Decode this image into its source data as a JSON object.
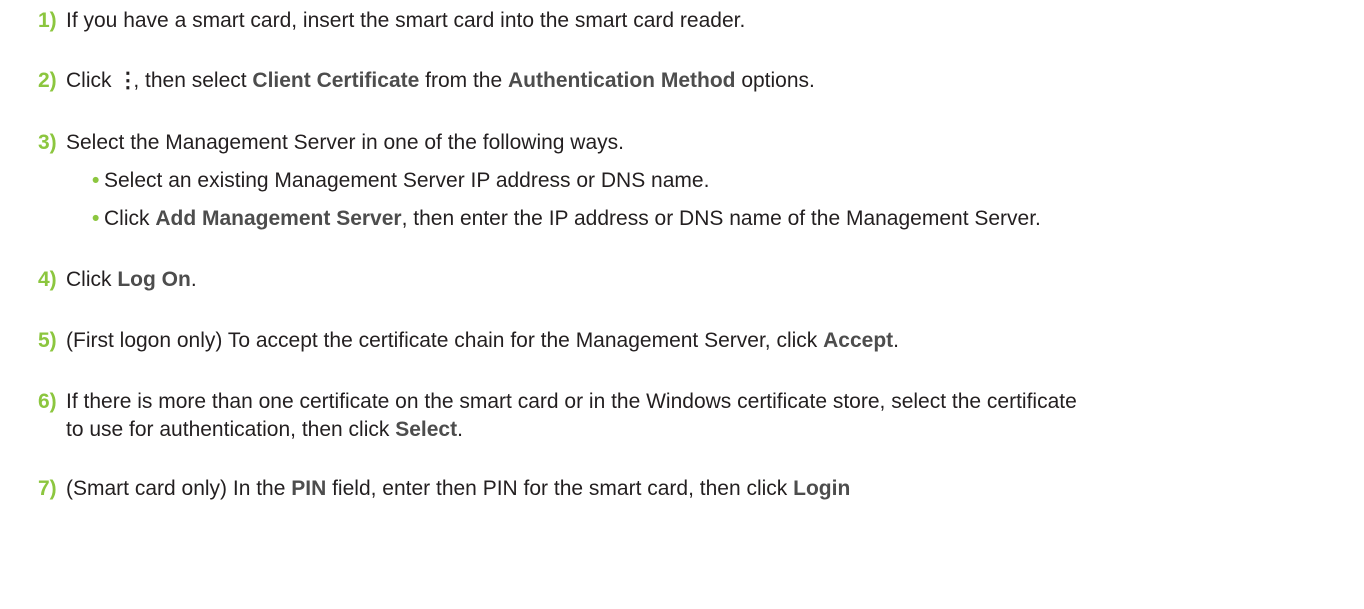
{
  "steps": [
    {
      "number": "1)",
      "text": "If you have a smart card, insert the smart card into the smart card reader."
    },
    {
      "number": "2)",
      "pre": "Click ",
      "icon": "⋮",
      "mid1": ", then select ",
      "bold1": "Client Certificate",
      "mid2": " from the ",
      "bold2": "Authentication Method",
      "post": " options."
    },
    {
      "number": "3)",
      "text": "Select the Management Server in one of the following ways.",
      "bullets": [
        {
          "text": "Select an existing Management Server IP address or DNS name."
        },
        {
          "pre": "Click ",
          "bold": "Add Management Server",
          "post": ", then enter the IP address or DNS name of the Management Server."
        }
      ]
    },
    {
      "number": "4)",
      "pre": "Click ",
      "bold": "Log On",
      "post": "."
    },
    {
      "number": "5)",
      "pre": "(First logon only) To accept the certificate chain for the Management Server, click ",
      "bold": "Accept",
      "post": "."
    },
    {
      "number": "6)",
      "line1": "If there is more than one certificate on the smart card or in the Windows certificate store, select the certificate",
      "pre": "to use for authentication, then click ",
      "bold": "Select",
      "post": "."
    },
    {
      "number": "7)",
      "pre": "(Smart card only) In the ",
      "bold1": "PIN",
      "mid": " field, enter then PIN for the smart card, then click ",
      "bold2": "Login"
    }
  ],
  "bullet_glyph": "•"
}
